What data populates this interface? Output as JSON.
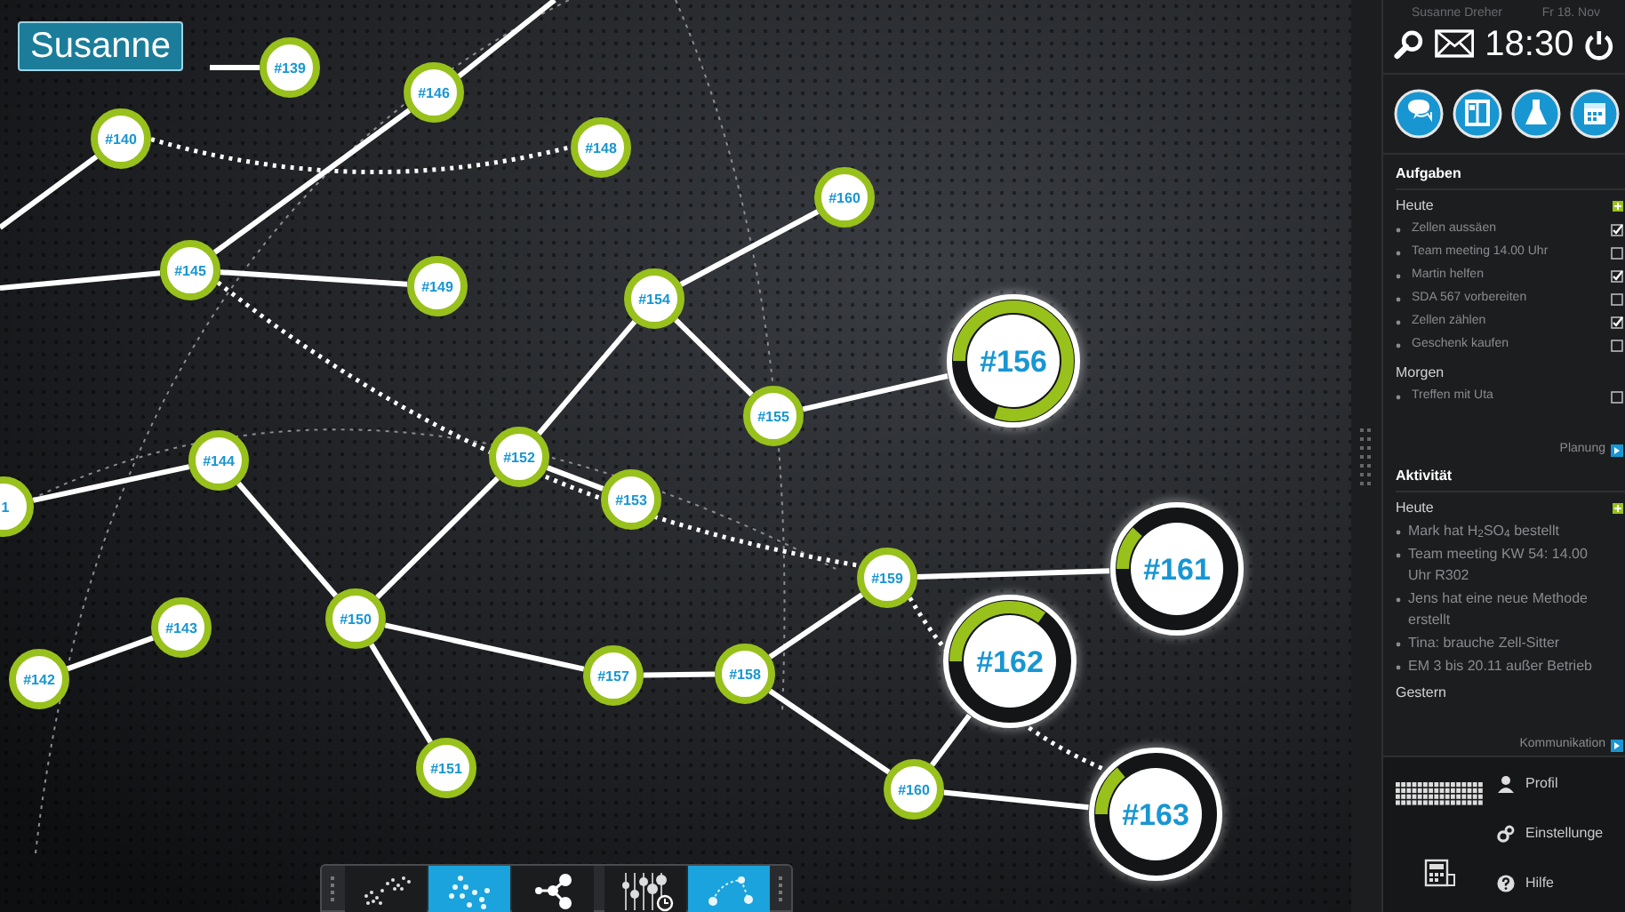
{
  "user_label": "Susanne",
  "graph": {
    "nodes": [
      {
        "label": "#139",
        "kind": "small"
      },
      {
        "label": "#140",
        "kind": "small"
      },
      {
        "label": "#146",
        "kind": "small"
      },
      {
        "label": "#148",
        "kind": "small"
      },
      {
        "label": "#145",
        "kind": "small"
      },
      {
        "label": "#149",
        "kind": "small"
      },
      {
        "label": "#154",
        "kind": "small"
      },
      {
        "label": "#160",
        "kind": "small"
      },
      {
        "label": "#155",
        "kind": "small"
      },
      {
        "label": "#156",
        "kind": "large",
        "level": 0.8
      },
      {
        "label": "#152",
        "kind": "small"
      },
      {
        "label": "#153",
        "kind": "small"
      },
      {
        "label": "#144",
        "kind": "small"
      },
      {
        "label": "1",
        "kind": "small"
      },
      {
        "label": "#143",
        "kind": "small"
      },
      {
        "label": "#142",
        "kind": "small"
      },
      {
        "label": "#150",
        "kind": "small"
      },
      {
        "label": "#157",
        "kind": "small"
      },
      {
        "label": "#158",
        "kind": "small"
      },
      {
        "label": "#159",
        "kind": "small"
      },
      {
        "label": "#151",
        "kind": "small"
      },
      {
        "label": "#160",
        "kind": "small"
      },
      {
        "label": "#161",
        "kind": "large",
        "level": 0.12
      },
      {
        "label": "#162",
        "kind": "large",
        "level": 0.35
      },
      {
        "label": "#163",
        "kind": "large",
        "level": 0.14
      }
    ]
  },
  "toolbar": [
    {
      "kind": "scatter",
      "selected": false
    },
    {
      "kind": "tree",
      "selected": true
    },
    {
      "kind": "branch",
      "selected": false
    },
    {
      "kind": "sliders",
      "selected": false
    },
    {
      "kind": "network",
      "selected": true
    }
  ],
  "header": {
    "user": "Susanne Dreher",
    "date": "Fr 18. Nov",
    "time": "18:30"
  },
  "apps": [
    {
      "kind": "chat"
    },
    {
      "kind": "book"
    },
    {
      "kind": "flask"
    },
    {
      "kind": "calendar"
    }
  ],
  "tasks": {
    "title": "Aufgaben",
    "groups": [
      {
        "title": "Heute",
        "add": true,
        "items": [
          {
            "text": "Zellen aussäen",
            "checked": true
          },
          {
            "text": "Team meeting 14.00 Uhr",
            "checked": false
          },
          {
            "text": "Martin helfen",
            "checked": true
          },
          {
            "text": "SDA 567 vorbereiten",
            "checked": false
          },
          {
            "text": "Zellen zählen",
            "checked": true
          },
          {
            "text": "Geschenk kaufen",
            "checked": false
          }
        ]
      },
      {
        "title": "Morgen",
        "add": false,
        "items": [
          {
            "text": "Treffen mit Uta",
            "checked": false
          }
        ]
      }
    ],
    "footer": "Planung"
  },
  "activity": {
    "title": "Aktivität",
    "groups": [
      {
        "title": "Heute",
        "add": true,
        "items": [
          "Mark hat H$_{2}$SO$_{4}$ bestellt",
          "Team meeting KW 54: 14.00 Uhr R302",
          "Jens hat eine neue Methode erstellt",
          "Tina: brauche Zell-Sitter",
          "EM 3 bis 20.11 außer Betrieb"
        ]
      },
      {
        "title": "Gestern",
        "add": false
      }
    ],
    "footer": "Kommunikation"
  },
  "menu": [
    {
      "kind": "profile",
      "label": "Profil"
    },
    {
      "kind": "settings",
      "label": "Einstellunge"
    },
    {
      "kind": "help",
      "label": "Hilfe"
    }
  ]
}
